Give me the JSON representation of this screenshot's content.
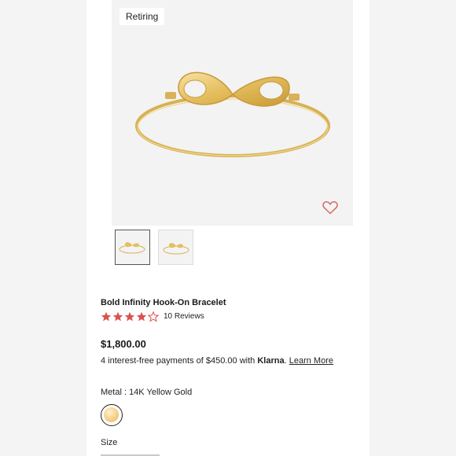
{
  "badge": "Retiring",
  "product": {
    "title": "Bold Infinity Hook-On Bracelet",
    "rating": 4.5,
    "reviews_label": "10 Reviews",
    "price": "$1,800.00",
    "installments": {
      "prefix": "4 interest-free payments of $450.00 with ",
      "provider": "Klarna",
      "suffix": ". ",
      "link": "Learn More"
    },
    "metal_label": "Metal : 14K Yellow Gold",
    "size_label": "Size"
  },
  "colors": {
    "star": "#d9534f",
    "heart": "#d86a6a",
    "gold": "#e8c15e"
  },
  "icons": {
    "wishlist": "heart-outline-icon",
    "rating": "star-icon"
  }
}
